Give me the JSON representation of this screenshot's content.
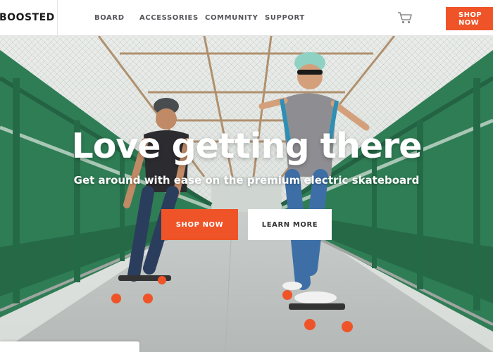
{
  "brand": {
    "logo_text": "BOOSTED"
  },
  "nav": {
    "links": [
      "BOARD",
      "ACCESSORIES",
      "COMMUNITY",
      "SUPPORT"
    ],
    "cart_icon": "shopping-cart-icon",
    "shop_label": "SHOP NOW"
  },
  "hero": {
    "title": "Love getting there",
    "subtitle": "Get around with ease on the premium electric skateboard",
    "primary_cta": "SHOP NOW",
    "secondary_cta": "LEARN MORE"
  },
  "colors": {
    "accent": "#ef5428",
    "nav_text": "#55565a",
    "railing_green": "#2f7d55"
  }
}
